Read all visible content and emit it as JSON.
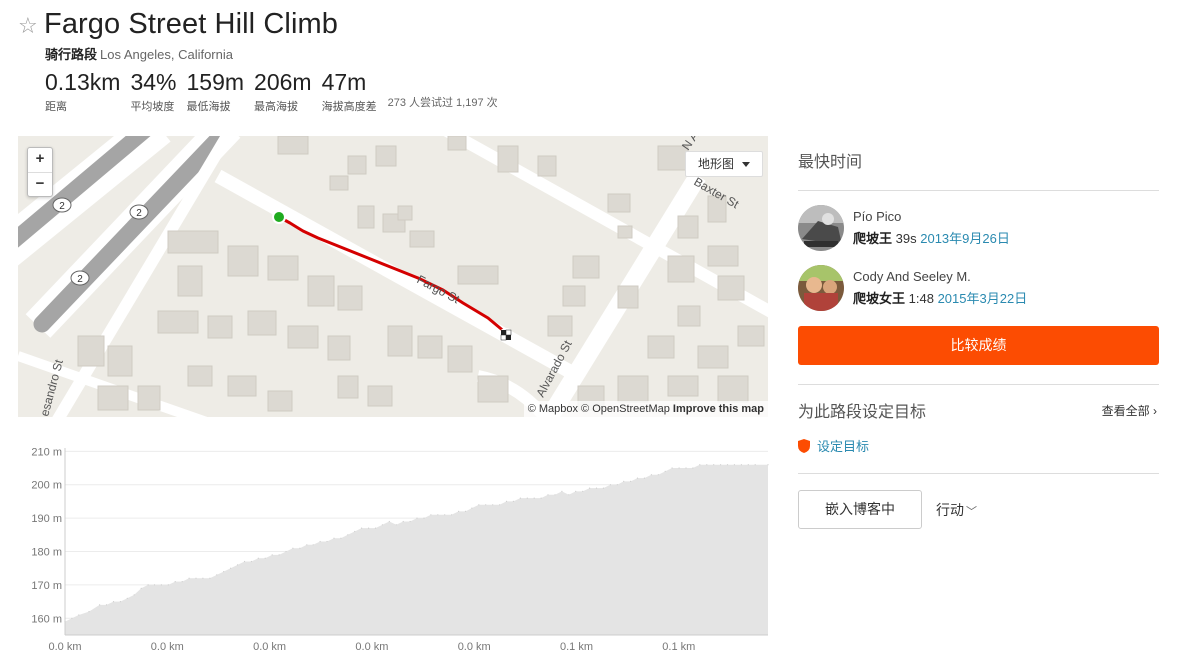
{
  "segment": {
    "title": "Fargo Street Hill Climb",
    "type_label": "骑行路段",
    "location": "Los Angeles, California"
  },
  "stats": [
    {
      "value": "0.13km",
      "label": "距离"
    },
    {
      "value": "34%",
      "label": "平均坡度"
    },
    {
      "value": "159m",
      "label": "最低海拔"
    },
    {
      "value": "206m",
      "label": "最高海拔"
    },
    {
      "value": "47m",
      "label": "海拔高度差"
    }
  ],
  "attempts_text": "273 人尝试过 1,197 次",
  "map": {
    "zoom_in": "+",
    "zoom_out": "−",
    "map_type": "地形图",
    "attribution_prefix": "© Mapbox © OpenStreetMap",
    "attribution_link": "Improve this map",
    "street_labels": [
      "Fargo St",
      "Baxter St",
      "Alvarado St",
      "esandro St",
      "N Al"
    ],
    "route_badges": [
      "2",
      "2",
      "2"
    ],
    "route_color": "#d40000",
    "start_color": "#1fab1f"
  },
  "chart_data": {
    "type": "area",
    "x_tick_labels": [
      "0.0 km",
      "0.0 km",
      "0.0 km",
      "0.0 km",
      "0.0 km",
      "0.1 km",
      "0.1 km"
    ],
    "ylabel_unit": "m",
    "y_ticks": [
      160,
      170,
      180,
      190,
      200,
      210
    ],
    "ylim": [
      155,
      211
    ],
    "xlim": [
      0,
      0.132
    ],
    "grid": true,
    "fill_color": "#e4e4e4",
    "x": [
      0,
      0.0013,
      0.0026,
      0.0045,
      0.0065,
      0.0078,
      0.0091,
      0.0104,
      0.0117,
      0.013,
      0.0143,
      0.0156,
      0.0168,
      0.0181,
      0.0194,
      0.0207,
      0.022,
      0.0233,
      0.0246,
      0.0259,
      0.0272,
      0.0285,
      0.0298,
      0.0311,
      0.0324,
      0.0337,
      0.035,
      0.0363,
      0.0376,
      0.0389,
      0.0402,
      0.0415,
      0.0428,
      0.0441,
      0.0454,
      0.0466,
      0.0479,
      0.0492,
      0.0505,
      0.0518,
      0.0531,
      0.0544,
      0.0557,
      0.057,
      0.0583,
      0.0596,
      0.0609,
      0.0622,
      0.0635,
      0.0648,
      0.0661,
      0.0674,
      0.0687,
      0.07,
      0.0713,
      0.0726,
      0.0739,
      0.0752,
      0.0764,
      0.0777,
      0.079,
      0.0803,
      0.0816,
      0.0829,
      0.0842,
      0.0855,
      0.0868,
      0.0881,
      0.0894,
      0.0907,
      0.092,
      0.0933,
      0.0946,
      0.0959,
      0.0972,
      0.0985,
      0.0998,
      0.1011,
      0.1024,
      0.1037,
      0.1049,
      0.1062,
      0.1075,
      0.1088,
      0.1101,
      0.1114,
      0.1127,
      0.114,
      0.1153,
      0.1166,
      0.1179,
      0.1192,
      0.1205,
      0.1218,
      0.1231,
      0.1244,
      0.1257,
      0.127,
      0.1283,
      0.1296,
      0.132
    ],
    "values": [
      159,
      160,
      161,
      162,
      164,
      164,
      165,
      165,
      166,
      167,
      169,
      170,
      170,
      170,
      170,
      171,
      171,
      172,
      172,
      172,
      172,
      173,
      174,
      175,
      176,
      177,
      177,
      178,
      178,
      179,
      179,
      180,
      181,
      181,
      182,
      182,
      183,
      183,
      184,
      184,
      185,
      186,
      187,
      187,
      187,
      188,
      189,
      188,
      189,
      189,
      190,
      190,
      191,
      191,
      191,
      191,
      192,
      192,
      193,
      194,
      194,
      194,
      194,
      195,
      195,
      196,
      196,
      196,
      196,
      197,
      197,
      198,
      197,
      198,
      198,
      199,
      199,
      199,
      200,
      200,
      201,
      201,
      202,
      202,
      203,
      203,
      204,
      205,
      205,
      205,
      205,
      206,
      206,
      206,
      206,
      206,
      206,
      206,
      206,
      206,
      206
    ]
  },
  "leaderboard": {
    "title": "最快时间",
    "entries": [
      {
        "name": "Pío Pico",
        "title": "爬坡王",
        "time": "39s",
        "date": "2013年9月26日"
      },
      {
        "name": "Cody And Seeley M.",
        "title": "爬坡女王",
        "time": "1:48",
        "date": "2015年3月22日"
      }
    ],
    "compare_button": "比较成绩"
  },
  "goals": {
    "title": "为此路段设定目标",
    "view_all": "查看全部",
    "set_goal": "设定目标"
  },
  "actions": {
    "embed": "嵌入博客中",
    "menu": "行动"
  }
}
